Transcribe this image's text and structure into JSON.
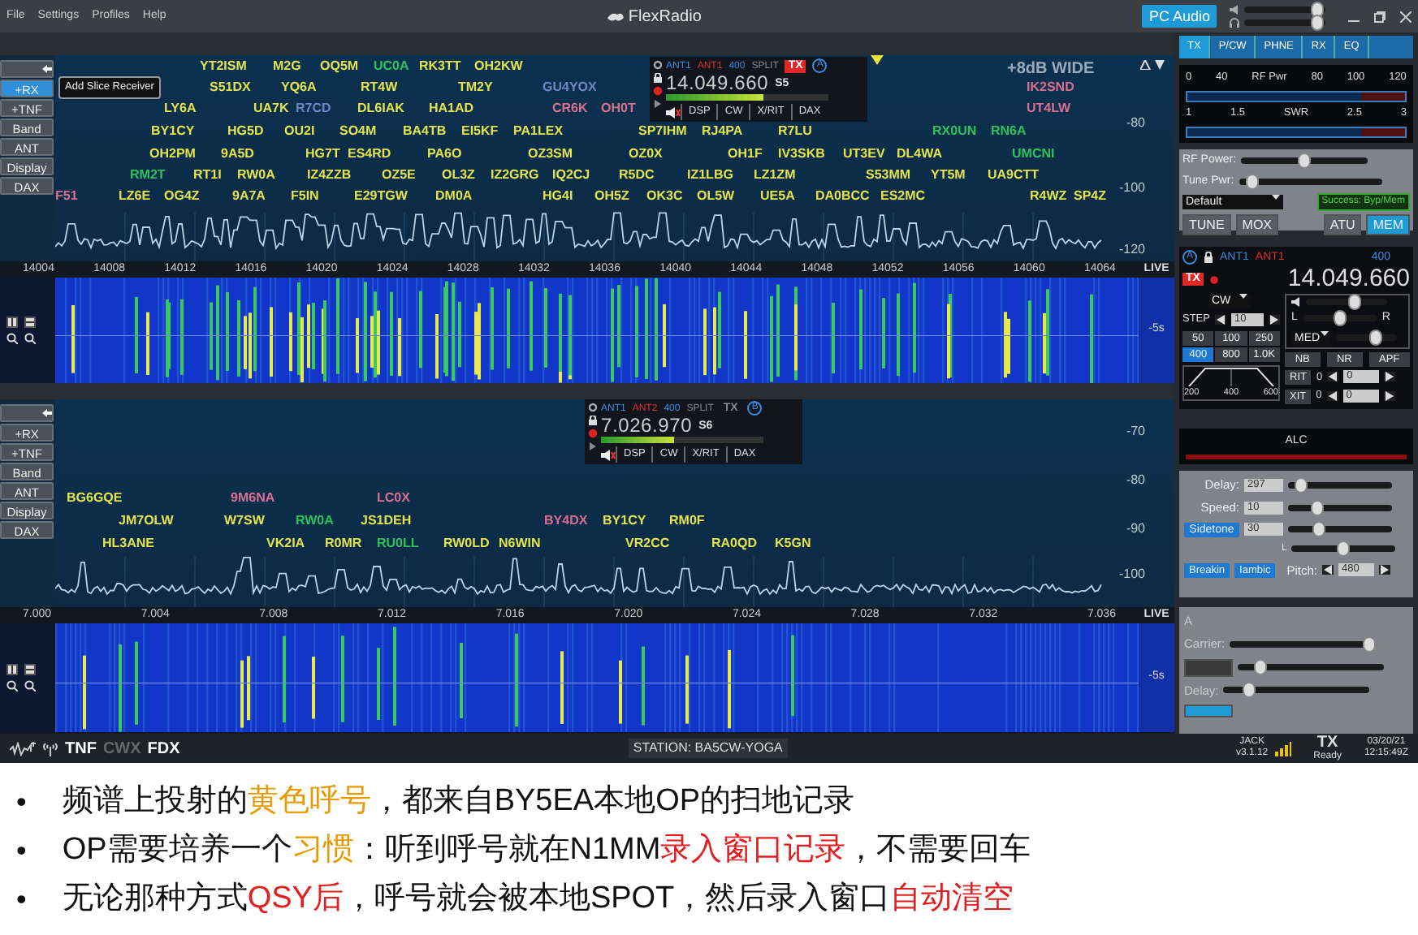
{
  "menu": [
    "File",
    "Settings",
    "Profiles",
    "Help"
  ],
  "app_title": "FlexRadio",
  "pc_audio": {
    "label": "PC Audio",
    "on": true
  },
  "master_volume": {
    "level": 0.9
  },
  "headphone_volume": {
    "level": 0.9
  },
  "panadapters": [
    {
      "side_buttons": [
        {
          "label": "+RX",
          "active": true
        },
        {
          "label": "+TNF",
          "active": false
        },
        {
          "label": "Band",
          "active": false
        },
        {
          "label": "ANT",
          "active": false
        },
        {
          "label": "Display",
          "active": false
        },
        {
          "label": "DAX",
          "active": false
        }
      ],
      "tooltip": "Add Slice Receiver",
      "header": "+8dB WIDE",
      "db_labels": [
        "-80",
        "-100",
        "-120"
      ],
      "spot_rows": [
        [
          {
            "call": "YT2ISM",
            "color": "#e4e44a"
          },
          {
            "call": "M2G",
            "color": "#e4e44a"
          },
          {
            "call": "OQ5M",
            "color": "#e4e44a"
          },
          {
            "call": "UC0A",
            "color": "#2ec25a"
          },
          {
            "call": "RK3TT",
            "color": "#e4e44a"
          },
          {
            "call": "OH2KW",
            "color": "#e4e44a"
          }
        ],
        [
          {
            "call": "S51DX",
            "color": "#e4e44a"
          },
          {
            "call": "YQ6A",
            "color": "#e4e44a"
          },
          {
            "call": "RT4W",
            "color": "#e4e44a"
          },
          {
            "call": "TM2Y",
            "color": "#e4e44a"
          },
          {
            "call": "GU4YOX",
            "color": "#6f86c4"
          },
          {
            "call": "IK2SND",
            "color": "#d9708f"
          }
        ],
        [
          {
            "call": "LY6A",
            "color": "#e4e44a"
          },
          {
            "call": "UA7K",
            "color": "#e4e44a"
          },
          {
            "call": "R7CD",
            "color": "#6f86c4"
          },
          {
            "call": "DL6IAK",
            "color": "#e4e44a"
          },
          {
            "call": "HA1AD",
            "color": "#e4e44a"
          },
          {
            "call": "CR6K",
            "color": "#d9708f"
          },
          {
            "call": "OH0T",
            "color": "#d9708f"
          },
          {
            "call": "UT4LW",
            "color": "#d9708f"
          }
        ],
        [
          {
            "call": "BY1CY",
            "color": "#e4e44a"
          },
          {
            "call": "HG5D",
            "color": "#e4e44a"
          },
          {
            "call": "OU2I",
            "color": "#e4e44a"
          },
          {
            "call": "SO4M",
            "color": "#e4e44a"
          },
          {
            "call": "BA4TB",
            "color": "#e4e44a"
          },
          {
            "call": "EI5KF",
            "color": "#e4e44a"
          },
          {
            "call": "PA1LEX",
            "color": "#e4e44a"
          },
          {
            "call": "SP7IHM",
            "color": "#e4e44a"
          },
          {
            "call": "RJ4PA",
            "color": "#e4e44a"
          },
          {
            "call": "R7LU",
            "color": "#e4e44a"
          },
          {
            "call": "RX0UN",
            "color": "#2ec25a"
          },
          {
            "call": "RN6A",
            "color": "#2ec25a"
          }
        ],
        [
          {
            "call": "OH2PM",
            "color": "#e4e44a"
          },
          {
            "call": "9A5D",
            "color": "#e4e44a"
          },
          {
            "call": "HG7T",
            "color": "#e4e44a"
          },
          {
            "call": "ES4RD",
            "color": "#e4e44a"
          },
          {
            "call": "PA6O",
            "color": "#e4e44a"
          },
          {
            "call": "OZ3SM",
            "color": "#e4e44a"
          },
          {
            "call": "OZ0X",
            "color": "#e4e44a"
          },
          {
            "call": "OH1F",
            "color": "#e4e44a"
          },
          {
            "call": "IV3SKB",
            "color": "#e4e44a"
          },
          {
            "call": "UT3EV",
            "color": "#e4e44a"
          },
          {
            "call": "DL4WA",
            "color": "#e4e44a"
          },
          {
            "call": "UMCNI",
            "color": "#2ec25a"
          }
        ],
        [
          {
            "call": "RM2T",
            "color": "#2ec25a"
          },
          {
            "call": "RT1I",
            "color": "#e4e44a"
          },
          {
            "call": "RW0A",
            "color": "#e4e44a"
          },
          {
            "call": "IZ4ZZB",
            "color": "#e4e44a"
          },
          {
            "call": "OZ5E",
            "color": "#e4e44a"
          },
          {
            "call": "OL3Z",
            "color": "#e4e44a"
          },
          {
            "call": "IZ2GRG",
            "color": "#e4e44a"
          },
          {
            "call": "IQ2CJ",
            "color": "#e4e44a"
          },
          {
            "call": "R5DC",
            "color": "#e4e44a"
          },
          {
            "call": "IZ1LBG",
            "color": "#e4e44a"
          },
          {
            "call": "LZ1ZM",
            "color": "#e4e44a"
          },
          {
            "call": "S53MM",
            "color": "#e4e44a"
          },
          {
            "call": "YT5M",
            "color": "#e4e44a"
          },
          {
            "call": "UA9CTT",
            "color": "#e4e44a"
          }
        ],
        [
          {
            "call": "F51",
            "color": "#d9708f"
          },
          {
            "call": "LZ6E",
            "color": "#e4e44a"
          },
          {
            "call": "OG4Z",
            "color": "#e4e44a"
          },
          {
            "call": "9A7A",
            "color": "#e4e44a"
          },
          {
            "call": "F5IN",
            "color": "#e4e44a"
          },
          {
            "call": "E29TGW",
            "color": "#e4e44a"
          },
          {
            "call": "DM0A",
            "color": "#e4e44a"
          },
          {
            "call": "HG4I",
            "color": "#e4e44a"
          },
          {
            "call": "OH5Z",
            "color": "#e4e44a"
          },
          {
            "call": "OK3C",
            "color": "#e4e44a"
          },
          {
            "call": "OL5W",
            "color": "#e4e44a"
          },
          {
            "call": "UE5A",
            "color": "#e4e44a"
          },
          {
            "call": "DA0BCC",
            "color": "#e4e44a"
          },
          {
            "call": "ES2MC",
            "color": "#e4e44a"
          },
          {
            "call": "R4WZ",
            "color": "#e4e44a"
          },
          {
            "call": "SP4Z",
            "color": "#e4e44a"
          }
        ]
      ],
      "slice": {
        "rx_ant": "ANT1",
        "tx_ant": "ANT1",
        "filter": "400",
        "split": "SPLIT",
        "tx": {
          "label": "TX",
          "on": true
        },
        "letter": "A",
        "freq": "14.049.660",
        "smeter": "S5",
        "meter": {
          "level": 0.6
        },
        "buttons": [
          "DSP",
          "CW",
          "X/RIT",
          "DAX"
        ]
      },
      "freq_labels": [
        "14004",
        "14008",
        "14012",
        "14016",
        "14020",
        "14024",
        "14028",
        "14032",
        "14036",
        "14040",
        "14044",
        "14048",
        "14052",
        "14056",
        "14060",
        "14064"
      ],
      "live": "LIVE",
      "time_label": "-5s"
    },
    {
      "side_buttons": [
        {
          "label": "+RX",
          "active": false
        },
        {
          "label": "+TNF",
          "active": false
        },
        {
          "label": "Band",
          "active": false
        },
        {
          "label": "ANT",
          "active": false
        },
        {
          "label": "Display",
          "active": false
        },
        {
          "label": "DAX",
          "active": false
        }
      ],
      "db_labels": [
        "-70",
        "-80",
        "-90",
        "-100"
      ],
      "spot_rows": [
        [
          {
            "call": "BG6GQE",
            "color": "#e4e44a"
          },
          {
            "call": "9M6NA",
            "color": "#d9708f"
          },
          {
            "call": "LC0X",
            "color": "#d9708f"
          }
        ],
        [
          {
            "call": "JM7OLW",
            "color": "#e4e44a"
          },
          {
            "call": "W7SW",
            "color": "#e4e44a"
          },
          {
            "call": "RW0A",
            "color": "#2ec25a"
          },
          {
            "call": "JS1DEH",
            "color": "#e4e44a"
          },
          {
            "call": "BY4DX",
            "color": "#d9708f"
          },
          {
            "call": "BY1CY",
            "color": "#e4e44a"
          },
          {
            "call": "RM0F",
            "color": "#e4e44a"
          }
        ],
        [
          {
            "call": "HL3ANE",
            "color": "#e4e44a"
          },
          {
            "call": "VK2IA",
            "color": "#e4e44a"
          },
          {
            "call": "R0MR",
            "color": "#e4e44a"
          },
          {
            "call": "RU0LL",
            "color": "#2ec25a"
          },
          {
            "call": "RW0LD",
            "color": "#e4e44a"
          },
          {
            "call": "N6WIN",
            "color": "#e4e44a"
          },
          {
            "call": "VR2CC",
            "color": "#e4e44a"
          },
          {
            "call": "RA0QD",
            "color": "#e4e44a"
          },
          {
            "call": "K5GN",
            "color": "#e4e44a"
          }
        ]
      ],
      "slice": {
        "rx_ant": "ANT1",
        "tx_ant": "ANT2",
        "filter": "400",
        "split": "SPLIT",
        "tx": {
          "label": "TX",
          "on": false
        },
        "letter": "B",
        "freq": "7.026.970",
        "smeter": "S6",
        "meter": {
          "level": 0.45
        },
        "buttons": [
          "DSP",
          "CW",
          "X/RIT",
          "DAX"
        ]
      },
      "freq_labels": [
        "7.000",
        "7.004",
        "7.008",
        "7.012",
        "7.016",
        "7.020",
        "7.024",
        "7.028",
        "7.032",
        "7.036"
      ],
      "live": "LIVE",
      "time_label": "-5s"
    }
  ],
  "tx_tabs": [
    {
      "label": "TX",
      "selected": true
    },
    {
      "label": "P/CW",
      "selected": false
    },
    {
      "label": "PHNE",
      "selected": false
    },
    {
      "label": "RX",
      "selected": false
    },
    {
      "label": "EQ",
      "selected": false
    }
  ],
  "power_scale": [
    "0",
    "40",
    "RF Pwr",
    "80",
    "100",
    "120"
  ],
  "swr_scale": [
    "1",
    "1.5",
    "SWR",
    "2.5",
    "3"
  ],
  "tx_sliders": [
    {
      "label": "RF Power:",
      "level": 0.5
    },
    {
      "label": "Tune Pwr:",
      "level": 0.1
    }
  ],
  "tx_profile": "Default",
  "atu_status": "Success: Byp/Mem",
  "tx_buttons": [
    {
      "label": "TUNE",
      "on": false
    },
    {
      "label": "MOX",
      "on": false
    },
    {
      "label": "ATU",
      "on": false
    },
    {
      "label": "MEM",
      "on": true
    }
  ],
  "slice_panel": {
    "letter": "A",
    "rx_ant": "ANT1",
    "tx_ant": "ANT1",
    "filter": "400",
    "tx": "TX",
    "freq": "14.049.660",
    "mode": "CW",
    "step_label": "STEP",
    "step": "10",
    "filters": [
      {
        "label": "50",
        "selected": false
      },
      {
        "label": "100",
        "selected": false
      },
      {
        "label": "250",
        "selected": false
      },
      {
        "label": "400",
        "selected": true
      },
      {
        "label": "800",
        "selected": false
      },
      {
        "label": "1.0K",
        "selected": false
      }
    ],
    "filter_scale": [
      "200",
      "400",
      "600"
    ],
    "volume": {
      "level": 0.6
    },
    "pan_left": "L",
    "pan_right": "R",
    "pan": {
      "level": 0.5
    },
    "agc": "MED",
    "agc_threshold": {
      "level": 0.65
    },
    "dsp": [
      {
        "label": "NB",
        "on": false
      },
      {
        "label": "NR",
        "on": false
      },
      {
        "label": "APF",
        "on": false
      }
    ],
    "offsets": [
      {
        "label": "RIT",
        "state": "0",
        "value": "0"
      },
      {
        "label": "XIT",
        "state": "0",
        "value": "0"
      }
    ]
  },
  "alc": "ALC",
  "cw": {
    "delay": {
      "label": "Delay:",
      "value": "297",
      "level": 0.12
    },
    "speed": {
      "label": "Speed:",
      "value": "10",
      "level": 0.28
    },
    "sidetone": {
      "label": "Sidetone",
      "value": "30",
      "level": 0.3,
      "on": true
    },
    "balance_label": "L",
    "balance": {
      "level": 0.5
    },
    "breakin": {
      "label": "Breakin",
      "on": true
    },
    "iambic": {
      "label": "Iambic",
      "on": true
    },
    "pitch_label": "Pitch:",
    "pitch": "480"
  },
  "cwx_panel": {
    "letter": "A",
    "carrier_label": "Carrier:",
    "carrier": {
      "level": 0.95
    },
    "second": {
      "level": 0.15
    },
    "delay_label": "Delay:",
    "delay": {
      "level": 0.18
    }
  },
  "status": {
    "toggles": [
      {
        "label": "TNF",
        "on": true
      },
      {
        "label": "CWX",
        "on": false
      },
      {
        "label": "FDX",
        "on": true
      }
    ],
    "station": "STATION: BA5CW-YOGA",
    "jack": "JACK",
    "version": "v3.1.12",
    "tx": "TX",
    "tx_state": "Ready",
    "date": "03/20/21",
    "time": "12:15:49Z"
  },
  "notes": [
    {
      "bullet": "•",
      "parts": [
        {
          "text": "频谱上投射的",
          "kind": "plain"
        },
        {
          "text": "黄色呼号",
          "kind": "accent"
        },
        {
          "text": "，都来自BY5EA本地OP的扫地记录",
          "kind": "plain"
        }
      ]
    },
    {
      "bullet": "•",
      "parts": [
        {
          "text": "OP需要培养一个",
          "kind": "plain"
        },
        {
          "text": "习惯",
          "kind": "accent"
        },
        {
          "text": "：听到呼号就在N1MM",
          "kind": "plain"
        },
        {
          "text": "录入窗口记录",
          "kind": "alert"
        },
        {
          "text": "，不需要回车",
          "kind": "plain"
        }
      ]
    },
    {
      "bullet": "•",
      "parts": [
        {
          "text": "无论那种方式",
          "kind": "plain"
        },
        {
          "text": "QSY后",
          "kind": "alert"
        },
        {
          "text": "，呼号就会被本地SPOT，然后录入窗口",
          "kind": "plain"
        },
        {
          "text": "自动清空",
          "kind": "alert"
        }
      ]
    }
  ]
}
